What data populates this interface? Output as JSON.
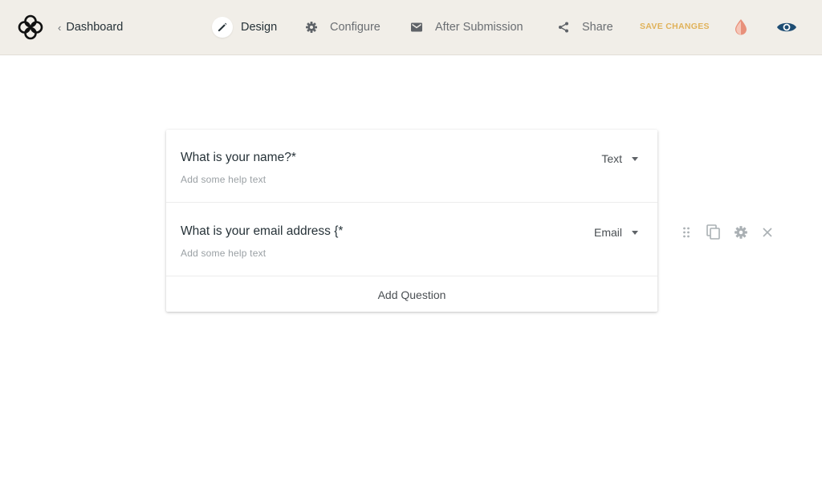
{
  "header": {
    "back_label": "Dashboard",
    "nav": [
      {
        "label": "Design",
        "icon": "pencil-icon",
        "active": true
      },
      {
        "label": "Configure",
        "icon": "gear-icon",
        "active": false
      },
      {
        "label": "After Submission",
        "icon": "mail-icon",
        "active": false
      },
      {
        "label": "Share",
        "icon": "share-icon",
        "active": false
      }
    ],
    "save_label": "SAVE CHANGES",
    "icons": {
      "logo": "logo-icon",
      "theme": "theme-drop-icon",
      "preview": "eye-icon"
    }
  },
  "form": {
    "questions": [
      {
        "title": "What is your name?*",
        "help": "Add some help text",
        "type": "Text"
      },
      {
        "title": "What is your email address {*",
        "help": "Add some help text",
        "type": "Email"
      }
    ],
    "add_label": "Add Question"
  },
  "colors": {
    "topbar_bg": "#f1eee8",
    "save_accent": "#e0b25a",
    "theme_drop": "#e8907a",
    "preview_eye": "#1e4d73"
  }
}
